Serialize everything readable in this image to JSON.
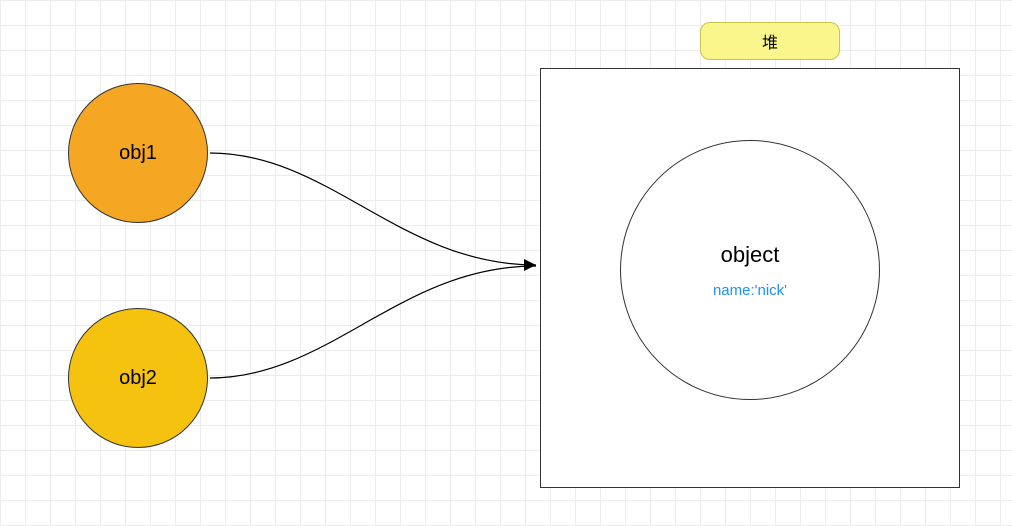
{
  "variables": [
    {
      "label": "obj1",
      "color": "#F5A623"
    },
    {
      "label": "obj2",
      "color": "#F5C30F"
    }
  ],
  "heap": {
    "label": "堆",
    "object": {
      "title": "object",
      "property": "name:'nick'"
    }
  },
  "edges": [
    {
      "from": "obj1",
      "to": "object"
    },
    {
      "from": "obj2",
      "to": "object"
    }
  ]
}
